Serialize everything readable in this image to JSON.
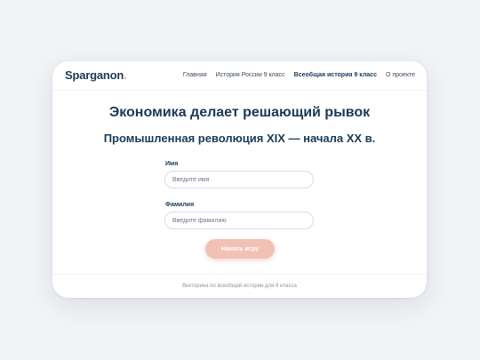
{
  "header": {
    "logo": "Sparganon",
    "logo_dot": ".",
    "nav": [
      {
        "label": "Главная"
      },
      {
        "label": "История России 9 класс"
      },
      {
        "label": "Всеобщая история 9 класс"
      },
      {
        "label": "О проекте"
      }
    ],
    "active_nav": "Всеобщая история 9 класс"
  },
  "main": {
    "title": "Экономика делает решающий рывок",
    "subtitle": "Промышленная революция XIX — начала XX в.",
    "name_label": "Имя",
    "name_placeholder": "Введите имя",
    "surname_label": "Фамилия",
    "surname_placeholder": "Введите фамилию",
    "start_button": "Начать игру"
  },
  "footer": {
    "text": "Викторина по всеобщей истории для 9 класса"
  },
  "colors": {
    "primary": "#1b3a57",
    "accent": "#f2c1b6",
    "background": "#f1f3f6"
  }
}
